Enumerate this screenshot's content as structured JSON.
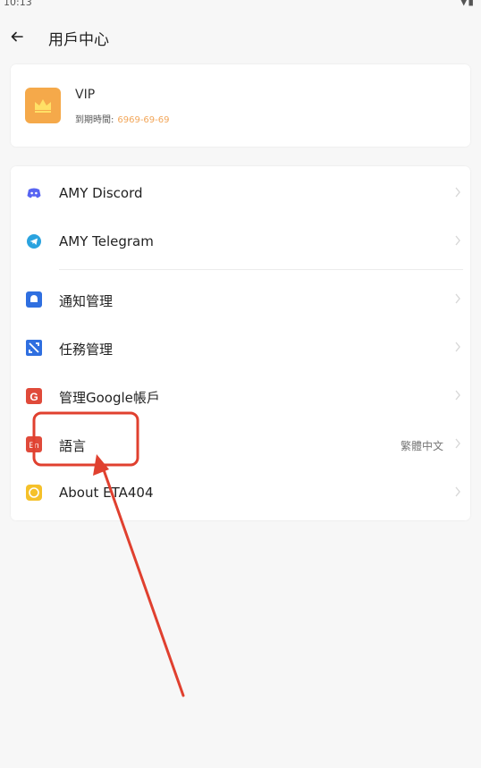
{
  "status_bar": {
    "time": "10:13",
    "icons": "▼▮"
  },
  "header": {
    "title": "用戶中心",
    "back_icon": "arrow-left-icon"
  },
  "vip": {
    "label": "VIP",
    "expiry_label": "到期時間:",
    "expiry_value": "6969-69-69",
    "icon": "crown-icon",
    "icon_color": "#f5a94a"
  },
  "menu": {
    "items": [
      {
        "label": "AMY Discord",
        "icon": "discord-icon",
        "color": "#5865f2"
      },
      {
        "label": "AMY Telegram",
        "icon": "telegram-icon",
        "color": "#2aa3df"
      },
      {
        "label": "通知管理",
        "icon": "notification-icon",
        "color": "#2f6fe0"
      },
      {
        "label": "任務管理",
        "icon": "task-icon",
        "color": "#2f6fe0"
      },
      {
        "label": "管理Google帳戶",
        "icon": "google-icon",
        "color": "#e04a3a"
      },
      {
        "label": "語言",
        "icon": "language-icon",
        "color": "#e04a3a",
        "value": "繁體中文"
      },
      {
        "label": "About ETA404",
        "icon": "info-icon",
        "color": "#f5c12a"
      }
    ]
  },
  "annotation": {
    "color": "#e0402f"
  }
}
